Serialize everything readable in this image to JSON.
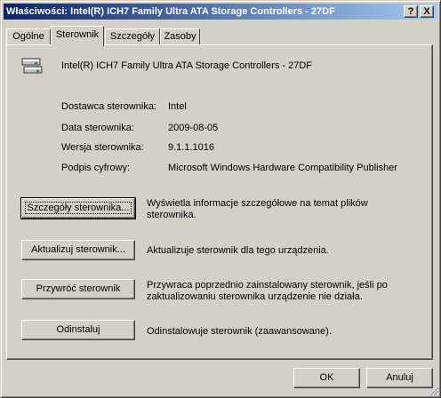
{
  "window": {
    "title": "Właściwości: Intel(R) ICH7 Family Ultra ATA Storage Controllers - 27DF",
    "help_label": "?",
    "close_label": "X"
  },
  "tabs": [
    {
      "label": "Ogólne",
      "active": false
    },
    {
      "label": "Sterownik",
      "active": true
    },
    {
      "label": "Szczegóły",
      "active": false
    },
    {
      "label": "Zasoby",
      "active": false
    }
  ],
  "device": {
    "icon": "storage-controller-icon",
    "name": "Intel(R) ICH7 Family Ultra ATA Storage Controllers - 27DF"
  },
  "info": [
    {
      "label": "Dostawca sterownika:",
      "value": "Intel"
    },
    {
      "label": "Data sterownika:",
      "value": "2009-08-05"
    },
    {
      "label": "Wersja sterownika:",
      "value": "9.1.1.1016"
    },
    {
      "label": "Podpis cyfrowy:",
      "value": "Microsoft Windows Hardware Compatibility Publisher"
    }
  ],
  "actions": [
    {
      "label": "Szczegóły sterownika...",
      "description": "Wyświetla informacje szczegółowe na temat plików sterownika."
    },
    {
      "label": "Aktualizuj sterownik...",
      "description": "Aktualizuje sterownik dla tego urządzenia."
    },
    {
      "label": "Przywróć sterownik",
      "description": "Przywraca poprzednio zainstalowany sterownik, jeśli po zaktualizowaniu sterownika urządzenie nie działa."
    },
    {
      "label": "Odinstaluj",
      "description": "Odinstalowuje sterownik (zaawansowane)."
    }
  ],
  "footer": {
    "ok_label": "OK",
    "cancel_label": "Anuluj"
  },
  "colors": {
    "titlebar_start": "#0a246a",
    "titlebar_end": "#a6caf0",
    "face": "#d4d0c8"
  }
}
